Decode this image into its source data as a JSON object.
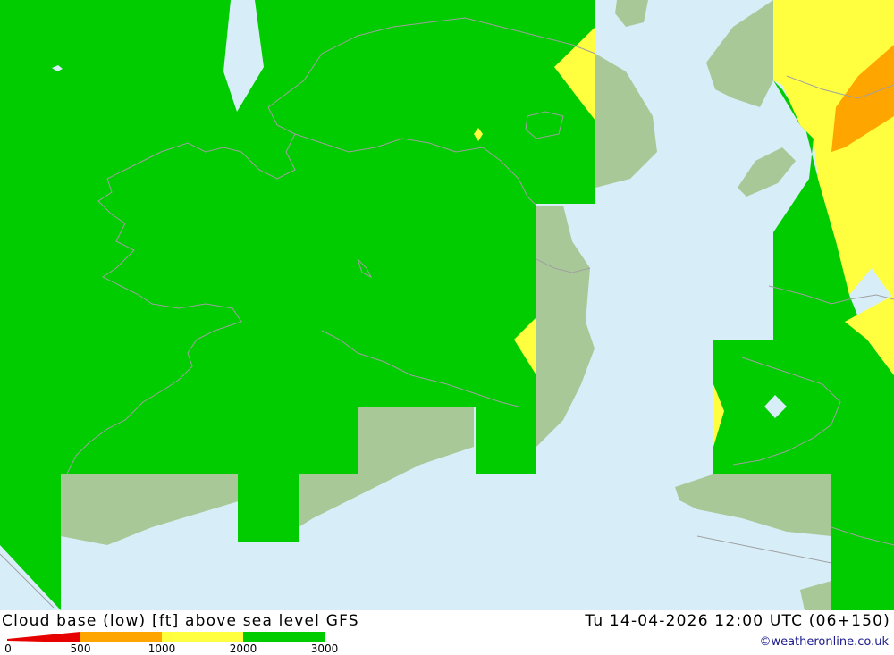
{
  "map": {
    "title": "Cloud base (low) [ft] above sea level GFS",
    "datetime": "Tu 14-04-2026 12:00 UTC (06+150)",
    "credit": "©weatheronline.co.uk",
    "colors": {
      "sea": "#d7eef9",
      "land": "#a8c898",
      "band_0_500": "#e60000",
      "band_500_1000": "#ffa500",
      "band_1000_2000": "#ffff40",
      "band_2000_3000": "#00cc00",
      "coastline": "#a0a0a0"
    }
  },
  "legend": {
    "ticks": [
      "0",
      "500",
      "1000",
      "2000",
      "3000"
    ]
  }
}
